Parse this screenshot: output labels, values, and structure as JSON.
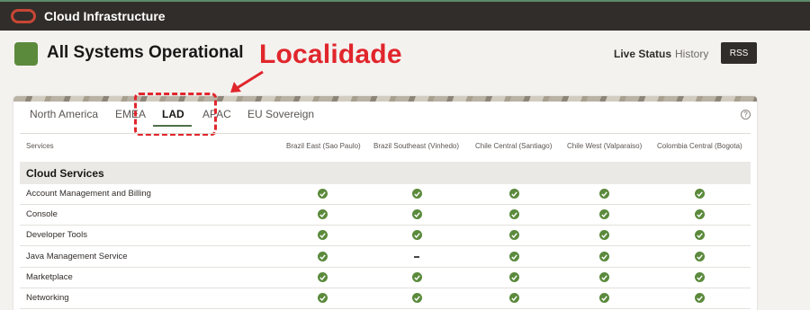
{
  "header": {
    "brand": "Cloud Infrastructure"
  },
  "status": {
    "headline": "All Systems Operational",
    "color": "#5b8a3c"
  },
  "annotation": {
    "text": "Localidade",
    "color": "#e0262c"
  },
  "nav": {
    "live_status": "Live Status",
    "history": "History",
    "rss": "RSS"
  },
  "tabs": [
    {
      "label": "North America"
    },
    {
      "label": "EMEA"
    },
    {
      "label": "LAD"
    },
    {
      "label": "APAC"
    },
    {
      "label": "EU Sovereign"
    }
  ],
  "active_tab": "LAD",
  "help_label": "?",
  "table": {
    "columns": [
      "Services",
      "Brazil East (Sao Paulo)",
      "Brazil Southeast (Vinhedo)",
      "Chile Central (Santiago)",
      "Chile West (Valparaiso)",
      "Colombia Central (Bogota)"
    ],
    "section_title": "Cloud Services",
    "rows": [
      {
        "name": "Account Management and Billing",
        "status": [
          "ok",
          "ok",
          "ok",
          "ok",
          "ok"
        ]
      },
      {
        "name": "Console",
        "status": [
          "ok",
          "ok",
          "ok",
          "ok",
          "ok"
        ]
      },
      {
        "name": "Developer Tools",
        "status": [
          "ok",
          "ok",
          "ok",
          "ok",
          "ok"
        ]
      },
      {
        "name": "Java Management Service",
        "status": [
          "ok",
          "none",
          "ok",
          "ok",
          "ok"
        ]
      },
      {
        "name": "Marketplace",
        "status": [
          "ok",
          "ok",
          "ok",
          "ok",
          "ok"
        ]
      },
      {
        "name": "Networking",
        "status": [
          "ok",
          "ok",
          "ok",
          "ok",
          "ok"
        ]
      }
    ]
  },
  "icons": {
    "logo": "oracle-logo-icon",
    "status": "check-circle-icon",
    "annotation_arrow": "arrow-icon",
    "ok": "check-circle-icon",
    "none": "dash-icon"
  }
}
